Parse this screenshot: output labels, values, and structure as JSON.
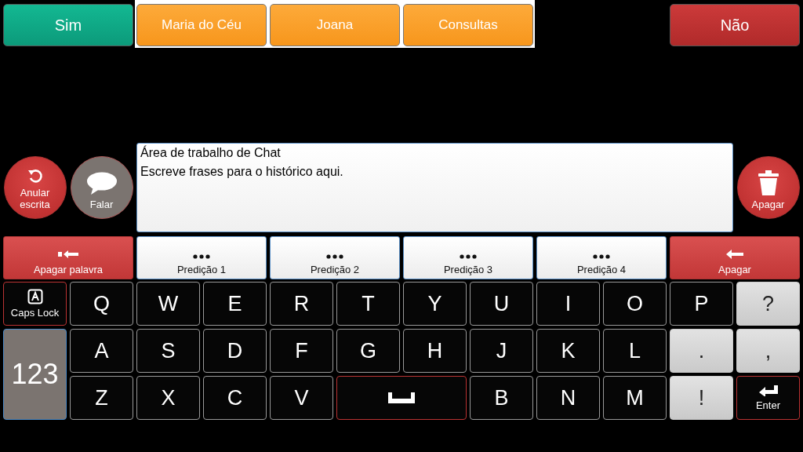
{
  "top_buttons": [
    {
      "label": "Sim",
      "kind": "yes"
    },
    {
      "label": "Maria do Céu",
      "kind": "contact"
    },
    {
      "label": "Joana",
      "kind": "contact"
    },
    {
      "label": "Consultas",
      "kind": "contact"
    },
    {
      "kind": "empty"
    },
    {
      "label": "Não",
      "kind": "no"
    }
  ],
  "actions": {
    "undo": {
      "label": "Anular escrita"
    },
    "speak": {
      "label": "Falar"
    },
    "clear": {
      "label": "Apagar"
    }
  },
  "text_area": {
    "value": "Área de trabalho de Chat\nEscreve frases para o histórico aqui."
  },
  "prediction_row": [
    {
      "label": "Apagar palavra",
      "kind": "delete-word"
    },
    {
      "label": "Predição 1",
      "kind": "prediction"
    },
    {
      "label": "Predição 2",
      "kind": "prediction"
    },
    {
      "label": "Predição 3",
      "kind": "prediction"
    },
    {
      "label": "Predição 4",
      "kind": "prediction"
    },
    {
      "label": "Apagar",
      "kind": "backspace"
    }
  ],
  "keys": [
    {
      "label": "Caps Lock",
      "kind": "caps"
    },
    {
      "label": "Q",
      "kind": "letter"
    },
    {
      "label": "W",
      "kind": "letter"
    },
    {
      "label": "E",
      "kind": "letter"
    },
    {
      "label": "R",
      "kind": "letter"
    },
    {
      "label": "T",
      "kind": "letter"
    },
    {
      "label": "Y",
      "kind": "letter"
    },
    {
      "label": "U",
      "kind": "letter"
    },
    {
      "label": "I",
      "kind": "letter"
    },
    {
      "label": "O",
      "kind": "letter"
    },
    {
      "label": "P",
      "kind": "letter"
    },
    {
      "label": "?",
      "kind": "punct"
    },
    {
      "label": "123",
      "kind": "numbers"
    },
    {
      "label": "A",
      "kind": "letter"
    },
    {
      "label": "S",
      "kind": "letter"
    },
    {
      "label": "D",
      "kind": "letter"
    },
    {
      "label": "F",
      "kind": "letter"
    },
    {
      "label": "G",
      "kind": "letter"
    },
    {
      "label": "H",
      "kind": "letter"
    },
    {
      "label": "J",
      "kind": "letter"
    },
    {
      "label": "K",
      "kind": "letter"
    },
    {
      "label": "L",
      "kind": "letter"
    },
    {
      "label": ".",
      "kind": "punct"
    },
    {
      "label": ",",
      "kind": "punct"
    },
    {
      "label": "Z",
      "kind": "letter"
    },
    {
      "label": "X",
      "kind": "letter"
    },
    {
      "label": "C",
      "kind": "letter"
    },
    {
      "label": "V",
      "kind": "letter"
    },
    {
      "kind": "space"
    },
    {
      "label": "B",
      "kind": "letter"
    },
    {
      "label": "N",
      "kind": "letter"
    },
    {
      "label": "M",
      "kind": "letter"
    },
    {
      "label": "!",
      "kind": "punct"
    },
    {
      "label": "Enter",
      "kind": "enter"
    }
  ]
}
